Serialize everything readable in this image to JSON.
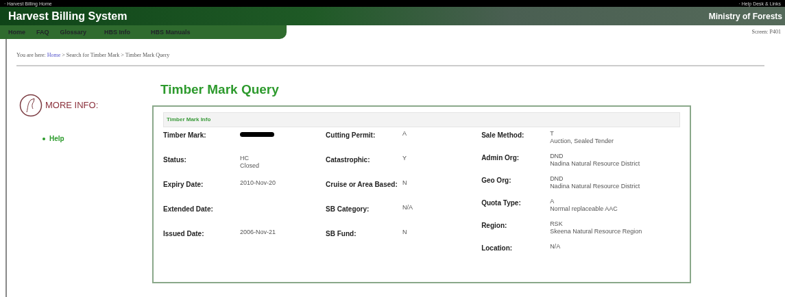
{
  "top_bar": {
    "left_link": "· Harvest Billing Home",
    "right_link": "· Help Desk & Links"
  },
  "banner": {
    "title": "Harvest Billing System",
    "ministry": "Ministry of Forests"
  },
  "nav": [
    {
      "label": "Home"
    },
    {
      "label": "FAQ"
    },
    {
      "label": "Glossary"
    },
    {
      "label": "HBS Info"
    },
    {
      "label": "HBS Manuals"
    }
  ],
  "screen_id": "Screen: P401",
  "breadcrumb": {
    "prefix": "You are here:",
    "separator": ">",
    "items": [
      {
        "label": "Home",
        "link": true
      },
      {
        "label": "Search for Timber Mark",
        "link": false
      },
      {
        "label": "Timber Mark Query",
        "link": false
      }
    ]
  },
  "sidebar": {
    "heading": "MORE INFO:",
    "links": [
      "Help"
    ]
  },
  "page_title": "Timber Mark Query",
  "panel": {
    "title": "Timber Mark Info",
    "columns": [
      {
        "fields": [
          {
            "label": "Timber Mark:",
            "redacted": true
          },
          {
            "label": "Status:",
            "value": [
              "HC",
              "Closed"
            ]
          },
          {
            "label": "Expiry Date:",
            "value": [
              "2010-Nov-20"
            ]
          },
          {
            "label": "Extended Date:"
          },
          {
            "label": "Issued Date:",
            "value": [
              "2006-Nov-21"
            ]
          }
        ]
      },
      {
        "fields": [
          {
            "label": "Cutting Permit:",
            "value": [
              "A"
            ]
          },
          {
            "label": "Catastrophic:",
            "value": [
              "Y"
            ]
          },
          {
            "label": "Cruise or Area Based:",
            "value": [
              "N"
            ]
          },
          {
            "label": "SB Category:",
            "value": [
              "N/A"
            ]
          },
          {
            "label": "SB Fund:",
            "value": [
              "N"
            ]
          }
        ]
      },
      {
        "fields": [
          {
            "label": "Sale Method:",
            "value": [
              "T",
              "Auction, Sealed Tender"
            ]
          },
          {
            "label": "Admin Org:",
            "value": [
              "DND",
              "Nadina Natural Resource District"
            ]
          },
          {
            "label": "Geo Org:",
            "value": [
              "DND",
              "Nadina Natural Resource District"
            ]
          },
          {
            "label": "Quota Type:",
            "value": [
              "A",
              "Normal replaceable AAC"
            ]
          },
          {
            "label": "Region:",
            "value": [
              "RSK",
              "Skeena Natural Resource Region"
            ]
          },
          {
            "label": "Location:",
            "value": [
              "N/A"
            ]
          }
        ]
      }
    ]
  }
}
